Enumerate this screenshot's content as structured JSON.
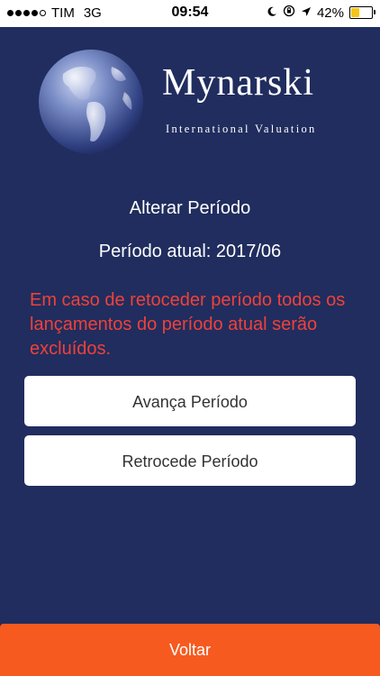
{
  "status_bar": {
    "carrier": "TIM",
    "network": "3G",
    "time": "09:54",
    "battery_percent": "42%",
    "battery_level": 0.42,
    "icons": [
      "moon-icon",
      "rotation-lock-icon",
      "location-arrow-icon"
    ]
  },
  "logo": {
    "name": "Mynarski",
    "subtitle": "International Valuation"
  },
  "screen": {
    "title": "Alterar Período",
    "current_period": "Período atual: 2017/06",
    "warning": "Em caso de retoceder período todos os lançamentos do período atual serão excluídos."
  },
  "buttons": {
    "advance": "Avança Período",
    "back": "Retrocede Período",
    "return": "Voltar"
  },
  "colors": {
    "background": "#202d5e",
    "warning": "#f0413a",
    "footer_button": "#f75a1f"
  }
}
